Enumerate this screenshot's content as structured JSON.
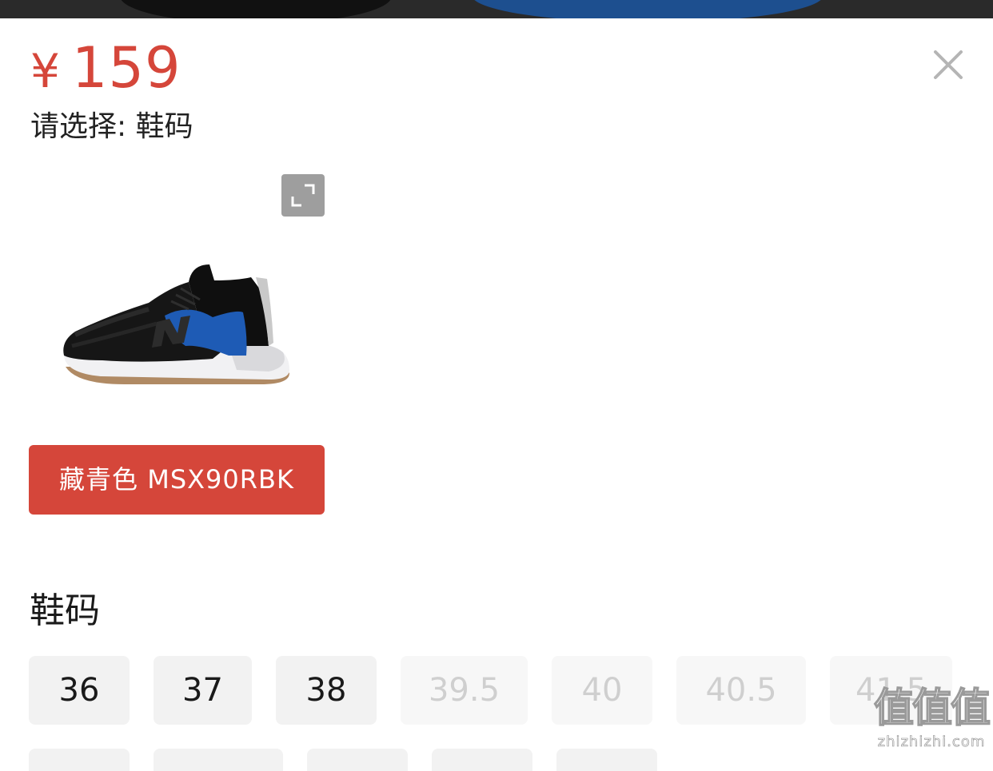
{
  "product": {
    "currency_symbol": "¥",
    "price": "159",
    "select_prompt": "请选择: 鞋码",
    "variant_label": "藏青色 MSX90RBK",
    "accent_color": "#d5463a"
  },
  "size_section": {
    "title": "鞋码",
    "sizes": [
      {
        "label": "36",
        "available": true
      },
      {
        "label": "37",
        "available": true
      },
      {
        "label": "38",
        "available": true
      },
      {
        "label": "39.5",
        "available": false
      },
      {
        "label": "40",
        "available": false
      },
      {
        "label": "40.5",
        "available": false
      },
      {
        "label": "41.5",
        "available": false
      }
    ]
  },
  "icons": {
    "close": "close-icon",
    "expand": "expand-icon"
  },
  "watermark": {
    "chars": "值值值",
    "url": "zhizhizhi.com"
  }
}
